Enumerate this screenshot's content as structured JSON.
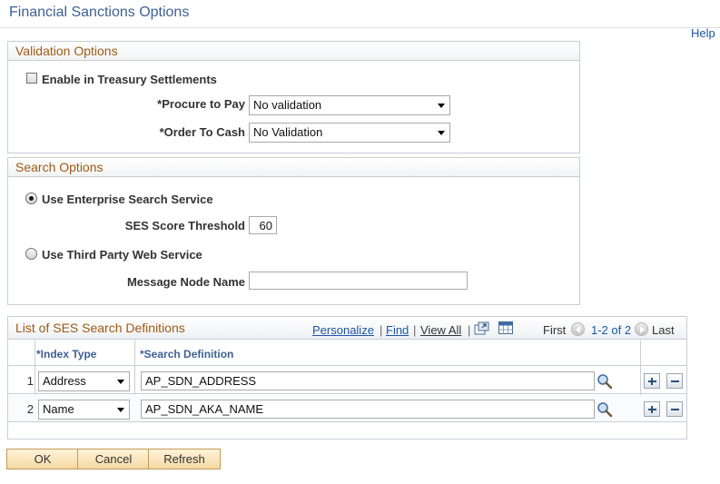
{
  "page": {
    "title": "Financial Sanctions Options",
    "help": "Help"
  },
  "validation": {
    "header": "Validation Options",
    "enable_label": "Enable in Treasury Settlements",
    "procure_label": "*Procure to Pay",
    "procure_value": "No validation",
    "order_label": "*Order To Cash",
    "order_value": "No Validation"
  },
  "search": {
    "header": "Search Options",
    "ses_label": "Use Enterprise Search Service",
    "threshold_label": "SES Score Threshold",
    "threshold_value": "60",
    "third_party_label": "Use Third Party Web Service",
    "node_label": "Message Node Name",
    "node_value": ""
  },
  "grid": {
    "title": "List of SES Search Definitions",
    "personalize": "Personalize",
    "find": "Find",
    "view_all": "View All",
    "sep": "|",
    "first": "First",
    "range": "1-2 of 2",
    "last": "Last",
    "col_index": "*Index Type",
    "col_search": "*Search Definition",
    "rows": [
      {
        "num": "1",
        "index_type": "Address",
        "definition": "AP_SDN_ADDRESS"
      },
      {
        "num": "2",
        "index_type": "Name",
        "definition": "AP_SDN_AKA_NAME"
      }
    ]
  },
  "buttons": {
    "ok": "OK",
    "cancel": "Cancel",
    "refresh": "Refresh"
  }
}
